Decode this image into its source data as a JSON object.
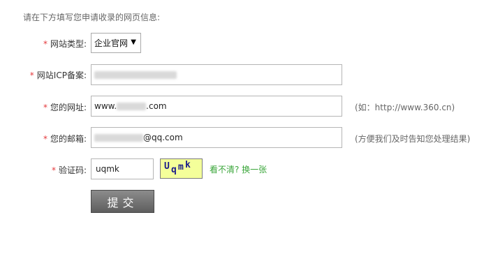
{
  "intro": "请在下方填写您申请收录的网页信息:",
  "required_mark": "*",
  "site_type": {
    "label": "网站类型:",
    "selected": "企业官网",
    "arrow_icon": "▼"
  },
  "icp": {
    "label": "网站ICP备案:",
    "value": ""
  },
  "url": {
    "label": "您的网址:",
    "value_prefix": "www.",
    "value_suffix": ".com",
    "hint": "(如：http://www.360.cn)"
  },
  "email": {
    "label": "您的邮箱:",
    "value_suffix": "@qq.com",
    "hint": "(方便我们及时告知您处理结果)"
  },
  "captcha": {
    "label": "验证码:",
    "value": "uqmk",
    "image_text": "Uqmk",
    "image_bg": "#f4ff9a",
    "refresh_text": "看不清? 换一张",
    "refresh_color": "#3aa63a"
  },
  "submit_label": "提交",
  "colors": {
    "required": "#e4393c",
    "submit_bg": "#6f6f6f"
  }
}
